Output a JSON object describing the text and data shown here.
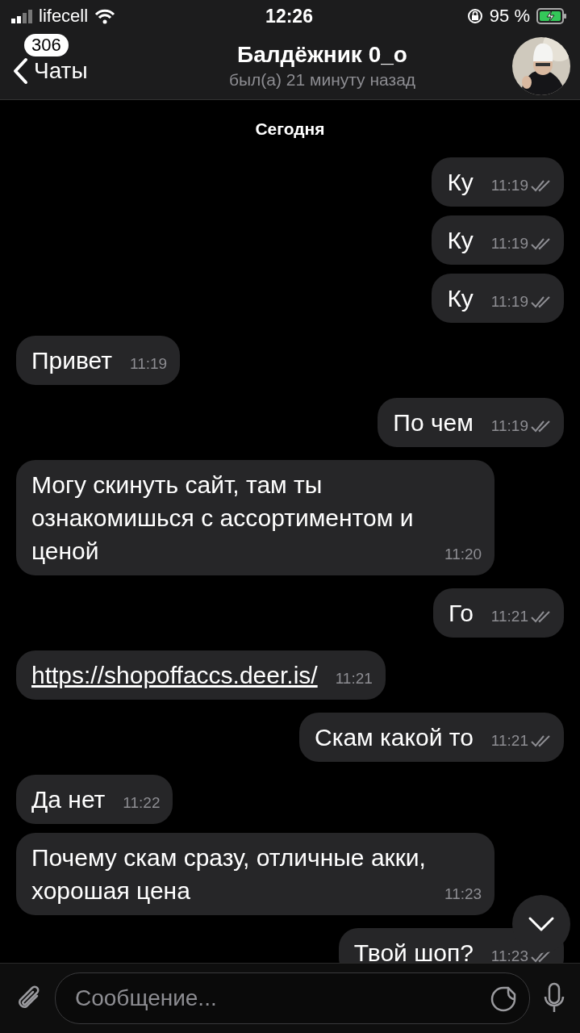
{
  "status_bar": {
    "carrier": "lifecell",
    "time": "12:26",
    "battery": "95 %"
  },
  "header": {
    "back_label": "Чаты",
    "unread_badge": "306",
    "title": "Балдёжник 0_o",
    "subtitle": "был(а) 21 минуту назад"
  },
  "chat": {
    "date": "Сегодня",
    "messages": [
      {
        "kind": "text",
        "outgoing": true,
        "read": true,
        "text": "Ку",
        "time": "11:19"
      },
      {
        "kind": "text",
        "outgoing": true,
        "read": true,
        "text": "Ку",
        "time": "11:19"
      },
      {
        "kind": "text",
        "outgoing": true,
        "read": true,
        "text": "Ку",
        "time": "11:19"
      },
      {
        "kind": "text",
        "outgoing": false,
        "text": "Привет",
        "time": "11:19"
      },
      {
        "kind": "text",
        "outgoing": true,
        "read": true,
        "text": "По чем",
        "time": "11:19"
      },
      {
        "kind": "text",
        "outgoing": false,
        "text": "Могу скинуть сайт, там ты ознакомишься с ассортиментом и ценой",
        "time": "11:20"
      },
      {
        "kind": "text",
        "outgoing": true,
        "read": true,
        "text": "Го",
        "time": "11:21"
      },
      {
        "kind": "link",
        "outgoing": false,
        "text": "https://shopoffaccs.deer.is/",
        "time": "11:21"
      },
      {
        "kind": "text",
        "outgoing": true,
        "read": true,
        "text": "Скам какой то",
        "time": "11:21"
      },
      {
        "kind": "text",
        "outgoing": false,
        "text": "Да нет",
        "time": "11:22"
      },
      {
        "kind": "text",
        "outgoing": false,
        "text": "Почему скам сразу, отличные акки, хорошая цена",
        "time": "11:23"
      },
      {
        "kind": "text",
        "outgoing": true,
        "read": true,
        "text": "Твой шоп?",
        "time": "11:23"
      }
    ]
  },
  "composer": {
    "placeholder": "Сообщение..."
  }
}
